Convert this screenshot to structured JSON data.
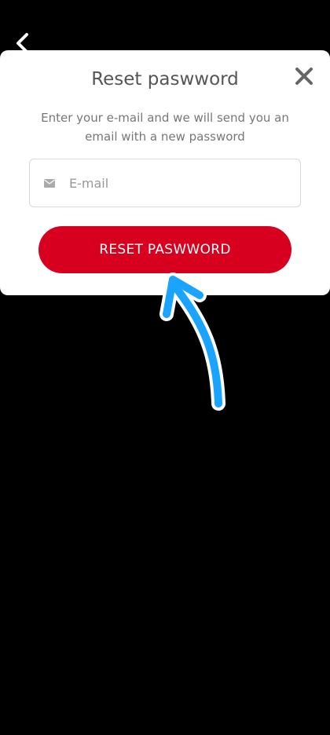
{
  "dialog": {
    "title": "Reset paswword",
    "subtitle": "Enter your e-mail and we will send you an email with a new password",
    "email_placeholder": "E-mail",
    "reset_label": "RESET PASWWORD"
  },
  "colors": {
    "accent": "#d7001f",
    "annotation": "#1aa3ff",
    "background": "#000000"
  },
  "icons": {
    "back": "chevron-left-icon",
    "close": "close-icon",
    "mail": "mail-icon"
  }
}
